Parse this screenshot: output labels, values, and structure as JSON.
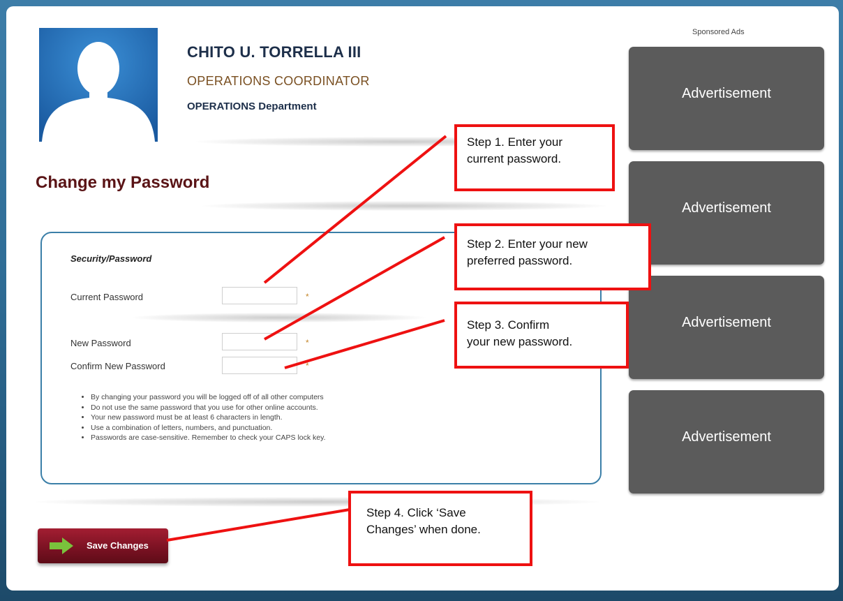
{
  "profile": {
    "name": "CHITO U. TORRELLA III",
    "title": "OPERATIONS COORDINATOR",
    "department": "OPERATIONS Department"
  },
  "page_title": "Change my Password",
  "form": {
    "section_title": "Security/Password",
    "fields": [
      {
        "label": "Current Password",
        "value": "",
        "required_mark": "*"
      },
      {
        "label": "New Password",
        "value": "",
        "required_mark": "*"
      },
      {
        "label": "Confirm New Password",
        "value": "",
        "required_mark": "*"
      }
    ],
    "notes": [
      "By changing your password you will be logged off of all other computers",
      "Do not use the same password that you use for other online accounts.",
      "Your new password must be at least 6 characters in length.",
      "Use a combination of letters, numbers, and punctuation.",
      "Passwords are case-sensitive. Remember to check your CAPS lock key."
    ],
    "save_label": "Save Changes"
  },
  "ads": {
    "label": "Sponsored Ads",
    "items": [
      "Advertisement",
      "Advertisement",
      "Advertisement",
      "Advertisement"
    ]
  },
  "callouts": [
    {
      "line1": "Step 1.  Enter your",
      "line2": "current password."
    },
    {
      "line1": "Step 2.  Enter your new",
      "line2": "preferred password."
    },
    {
      "line1": "Step 3.  Confirm",
      "line2": "your new password."
    },
    {
      "line1": "Step 4.  Click ‘Save",
      "line2": "Changes’ when done."
    }
  ],
  "colors": {
    "page_background": "#2f6d96",
    "panel_border": "#3b7fa8",
    "name_text": "#1d2f4a",
    "title_text": "#7a5022",
    "heading_text": "#5a1416",
    "save_button": "#7c1223",
    "save_arrow": "#7ac23c",
    "ad_background": "#5b5b5b",
    "callout_border": "#ee1111"
  },
  "icons": {
    "avatar": "person-silhouette-icon",
    "save": "arrow-right-icon"
  }
}
